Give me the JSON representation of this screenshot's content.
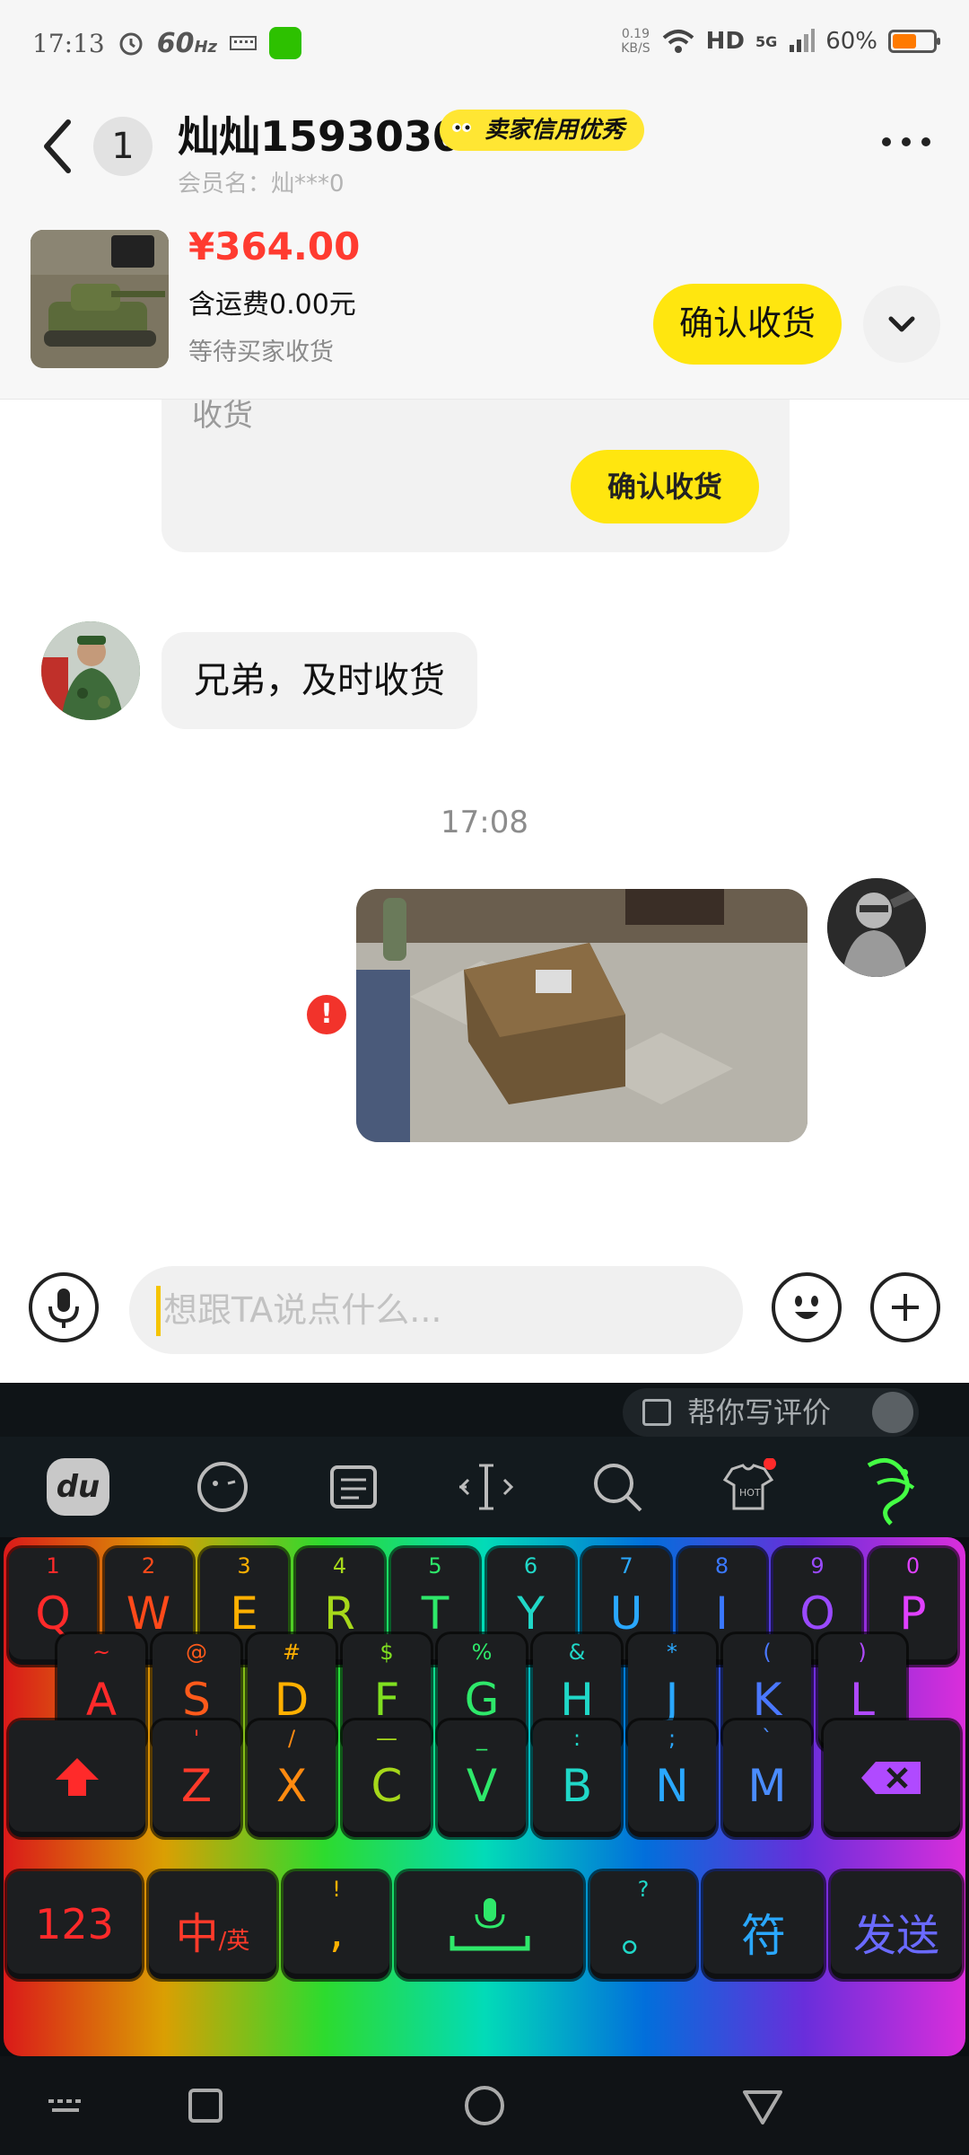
{
  "status_bar": {
    "time": "17:13",
    "refresh_rate": "60",
    "refresh_unit": "Hz",
    "net_speed_value": "0.19",
    "net_speed_unit": "KB/S",
    "hd": "HD",
    "network": "5G",
    "battery": "60%",
    "battery_level": 0.6
  },
  "header": {
    "unread_count": "1",
    "contact_name": "灿灿1593030",
    "credit_badge": "卖家信用优秀",
    "member_label": "会员名：灿***0"
  },
  "order": {
    "price": "¥364.00",
    "shipping": "含运费0.00元",
    "status": "等待买家收货",
    "confirm_label": "确认收货"
  },
  "messages": {
    "card_cut_text": "收货",
    "card_confirm_label": "确认收货",
    "text_message": "兄弟，及时收货",
    "timestamp": "17:08",
    "error_mark": "!"
  },
  "input": {
    "placeholder": "想跟TA说点什么..."
  },
  "keyboard": {
    "review_chip": "帮你写评价",
    "logo_text": "du",
    "row1": [
      {
        "sub": "1",
        "main": "Q",
        "color": "#ff2a2a"
      },
      {
        "sub": "2",
        "main": "W",
        "color": "#ff4a1a"
      },
      {
        "sub": "3",
        "main": "E",
        "color": "#ffb000"
      },
      {
        "sub": "4",
        "main": "R",
        "color": "#a6d81a"
      },
      {
        "sub": "5",
        "main": "T",
        "color": "#2ee86a"
      },
      {
        "sub": "6",
        "main": "Y",
        "color": "#20d8c8"
      },
      {
        "sub": "7",
        "main": "U",
        "color": "#2aa8ff"
      },
      {
        "sub": "8",
        "main": "I",
        "color": "#3a78ff"
      },
      {
        "sub": "9",
        "main": "O",
        "color": "#9a4aff"
      },
      {
        "sub": "0",
        "main": "P",
        "color": "#e040ff"
      }
    ],
    "row2": [
      {
        "sub": "~",
        "main": "A",
        "color": "#ff2a2a"
      },
      {
        "sub": "@",
        "main": "S",
        "color": "#ff5a1a"
      },
      {
        "sub": "#",
        "main": "D",
        "color": "#ffb000"
      },
      {
        "sub": "$",
        "main": "F",
        "color": "#80e020"
      },
      {
        "sub": "%",
        "main": "G",
        "color": "#2ee86a"
      },
      {
        "sub": "&",
        "main": "H",
        "color": "#20d8c8"
      },
      {
        "sub": "*",
        "main": "J",
        "color": "#2aa8ff"
      },
      {
        "sub": "(",
        "main": "K",
        "color": "#4a78ff"
      },
      {
        "sub": ")",
        "main": "L",
        "color": "#b04aff"
      }
    ],
    "row3": [
      {
        "sub": "'",
        "main": "Z",
        "color": "#ff3a2a"
      },
      {
        "sub": "/",
        "main": "X",
        "color": "#ff8a10"
      },
      {
        "sub": "—",
        "main": "C",
        "color": "#a6d81a"
      },
      {
        "sub": "_",
        "main": "V",
        "color": "#2ee86a"
      },
      {
        "sub": ":",
        "main": "B",
        "color": "#20d8c8"
      },
      {
        "sub": ";",
        "main": "N",
        "color": "#2aa8ff"
      },
      {
        "sub": "`",
        "main": "M",
        "color": "#4a8cff"
      }
    ],
    "row4": {
      "num": "123",
      "lang_main": "中",
      "lang_sub": "/英",
      "punct_sub": "!",
      "punct_main": ",",
      "q_sub": "?",
      "q_main": "。",
      "symbols": "符",
      "send": "发送"
    }
  },
  "icons": {
    "back": "chevron-left-icon",
    "more": "more-dots-icon",
    "collapse": "chevron-down-icon",
    "voice": "microphone-icon",
    "emoji": "smile-icon",
    "plus": "plus-icon"
  },
  "colors": {
    "accent_yellow": "#ffe60f",
    "price_red": "#ff3b30",
    "error_red": "#f2332b"
  }
}
